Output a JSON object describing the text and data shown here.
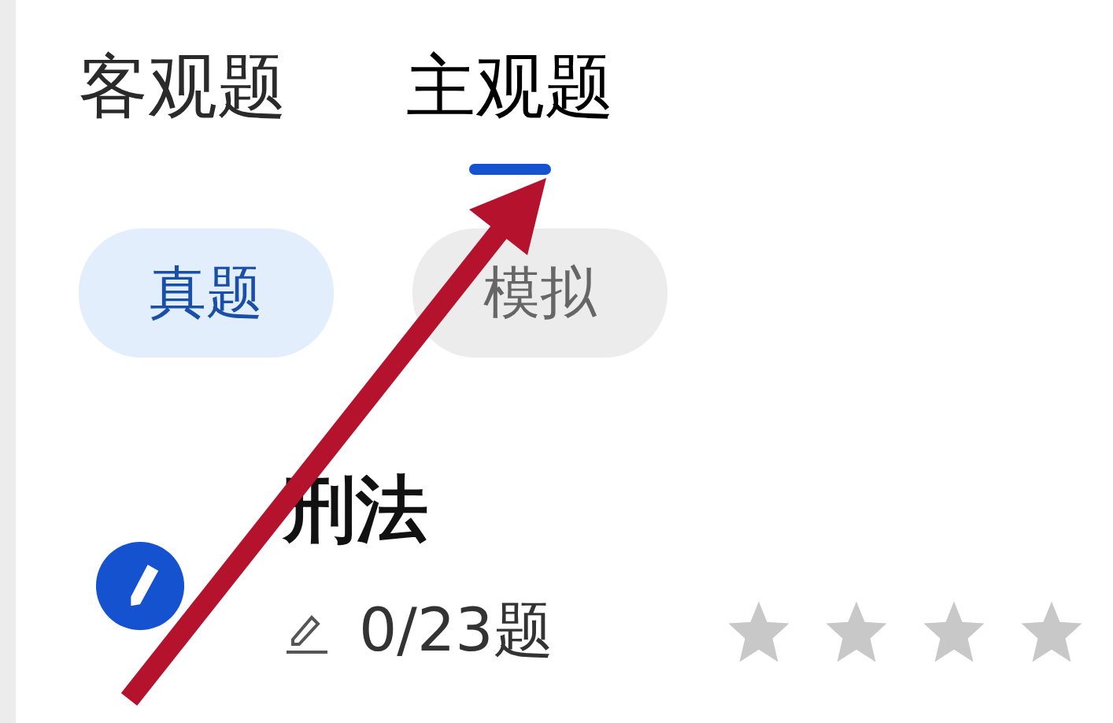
{
  "tabs": [
    {
      "label": "客观题",
      "selected": false
    },
    {
      "label": "主观题",
      "selected": true
    }
  ],
  "filters": [
    {
      "label": "真题",
      "selected": true
    },
    {
      "label": "模拟",
      "selected": false
    }
  ],
  "subject": {
    "title": "刑法",
    "progress": "0/23题",
    "stars": 0
  }
}
